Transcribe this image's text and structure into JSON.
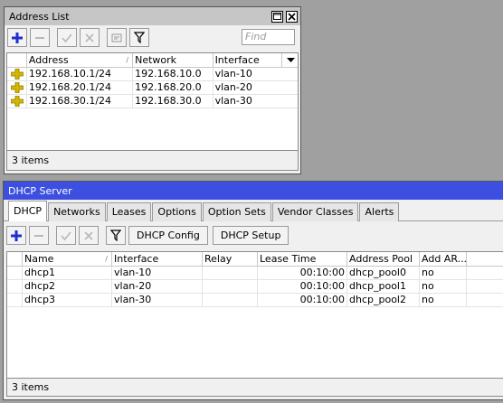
{
  "address_window": {
    "title": "Address List",
    "find_placeholder": "Find",
    "columns": [
      "Address",
      "Network",
      "Interface"
    ],
    "rows": [
      {
        "address": "192.168.10.1/24",
        "network": "192.168.10.0",
        "interface": "vlan-10"
      },
      {
        "address": "192.168.20.1/24",
        "network": "192.168.20.0",
        "interface": "vlan-20"
      },
      {
        "address": "192.168.30.1/24",
        "network": "192.168.30.0",
        "interface": "vlan-30"
      }
    ],
    "status": "3 items"
  },
  "dhcp_window": {
    "title": "DHCP Server",
    "tabs": [
      "DHCP",
      "Networks",
      "Leases",
      "Options",
      "Option Sets",
      "Vendor Classes",
      "Alerts"
    ],
    "buttons": {
      "config": "DHCP Config",
      "setup": "DHCP Setup"
    },
    "columns": [
      "Name",
      "Interface",
      "Relay",
      "Lease Time",
      "Address Pool",
      "Add AR..."
    ],
    "rows": [
      {
        "name": "dhcp1",
        "interface": "vlan-10",
        "relay": "",
        "lease_time": "00:10:00",
        "pool": "dhcp_pool0",
        "add_arp": "no"
      },
      {
        "name": "dhcp2",
        "interface": "vlan-20",
        "relay": "",
        "lease_time": "00:10:00",
        "pool": "dhcp_pool1",
        "add_arp": "no"
      },
      {
        "name": "dhcp3",
        "interface": "vlan-30",
        "relay": "",
        "lease_time": "00:10:00",
        "pool": "dhcp_pool2",
        "add_arp": "no"
      }
    ],
    "status": "3 items"
  },
  "icons": {
    "add": "plus-icon",
    "remove": "minus-icon",
    "enable": "check-icon",
    "disable": "x-icon",
    "comment": "comment-icon",
    "filter": "filter-icon",
    "address_entry": "address-plus-icon"
  },
  "colors": {
    "title_active": "#3c4fe0",
    "title_inactive": "#c6c6c6",
    "add_blue": "#1d2fd0",
    "address_icon": "#d4b800"
  }
}
